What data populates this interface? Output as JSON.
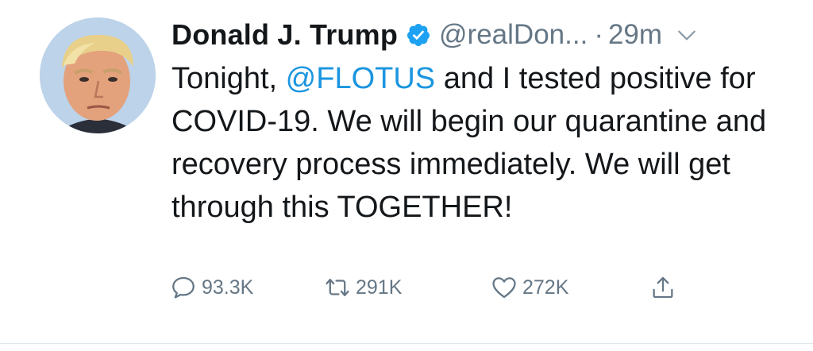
{
  "tweet": {
    "name": "Donald J. Trump",
    "verified_icon": "verified-badge-icon",
    "handle": "@realDon...",
    "separator": "·",
    "time": "29m",
    "menu_icon": "chevron-down-icon",
    "text_before_mention": "Tonight, ",
    "mention": "@FLOTUS",
    "text_after_mention": " and I tested positive for COVID-19. We will begin our quarantine and recovery process immediately. We will get through this TOGETHER!",
    "mention_color": "#1b95e0",
    "verified_color": "#1da1f2"
  },
  "actions": {
    "reply": {
      "icon": "reply-icon",
      "count": "93.3K"
    },
    "retweet": {
      "icon": "retweet-icon",
      "count": "291K"
    },
    "like": {
      "icon": "heart-icon",
      "count": "272K"
    },
    "share": {
      "icon": "share-icon"
    }
  }
}
